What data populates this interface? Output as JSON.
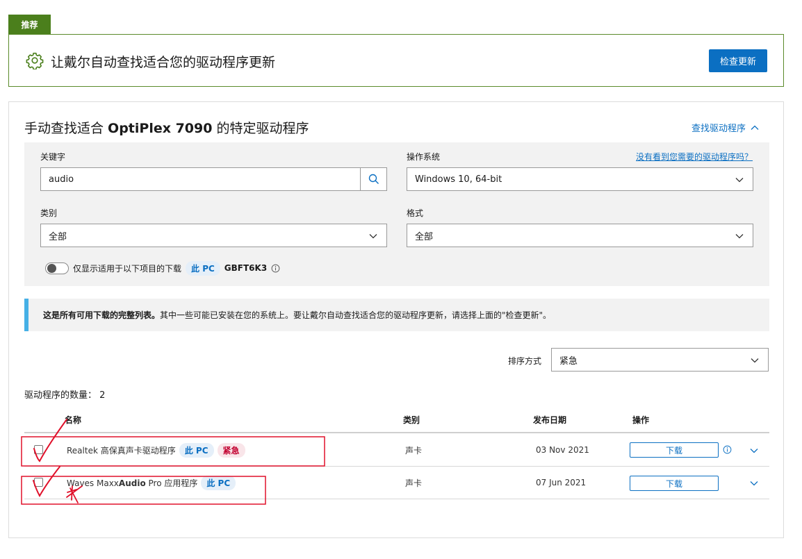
{
  "recommend": {
    "tab_label": "推荐",
    "text": "让戴尔自动查找适合您的驱动程序更新",
    "check_button": "检查更新",
    "icon": "gear-icon"
  },
  "manual": {
    "title_prefix": "手动查找适合 ",
    "title_model": "OptiPlex 7090",
    "title_suffix": " 的特定驱动程序",
    "find_link": "查找驱动程序",
    "keyword_label": "关键字",
    "keyword_value": "audio",
    "os_label": "操作系统",
    "os_help_link": "没有看到您需要的驱动程序吗？",
    "os_value": "Windows 10, 64-bit",
    "category_label": "类别",
    "category_value": "全部",
    "format_label": "格式",
    "format_value": "全部",
    "toggle_text": "仅显示适用于以下项目的下载",
    "this_pc": "此 PC",
    "service_tag": "GBFT6K3"
  },
  "notice": {
    "bold": "这是所有可用下载的完整列表。",
    "text": "其中一些可能已安装在您的系统上。要让戴尔自动查找适合您的驱动程序更新，请选择上面的\"检查更新\"。"
  },
  "sort": {
    "label": "排序方式",
    "value": "紧急"
  },
  "count": {
    "label": "驱动程序的数量：",
    "value": "2"
  },
  "table": {
    "headers": {
      "name": "名称",
      "category": "类别",
      "date": "发布日期",
      "action": "操作"
    },
    "rows": [
      {
        "name": "Realtek 高保真声卡驱动程序",
        "tag_pc": "此 PC",
        "tag_urgent": "紧急",
        "category": "声卡",
        "date": "03 Nov 2021",
        "download": "下载"
      },
      {
        "name_pre": "Waves Maxx",
        "name_bold": "Audio",
        "name_post": " Pro 应用程序",
        "tag_pc": "此 PC",
        "category": "声卡",
        "date": "07 Jun 2021",
        "download": "下载"
      }
    ]
  },
  "colors": {
    "recommend_green": "#4b7f1c",
    "primary_blue": "#0b6fc2",
    "notice_bar": "#46b0e6",
    "urgent_red": "#c2002f",
    "annotation_red": "#e0102a"
  }
}
